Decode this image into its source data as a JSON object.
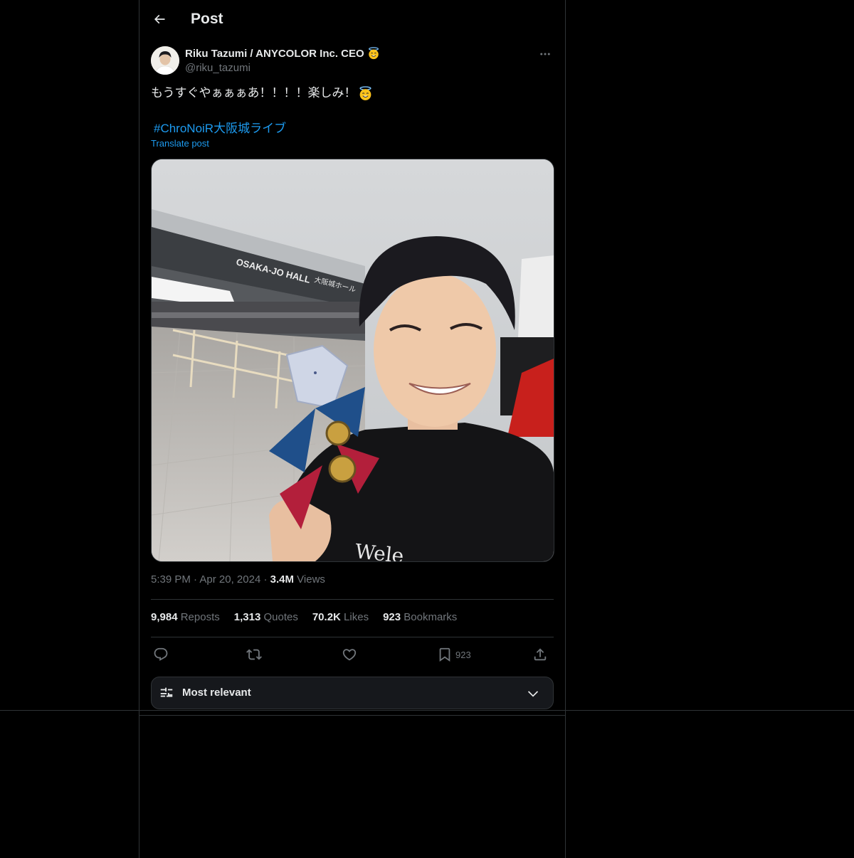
{
  "header": {
    "back_icon": "arrow-left-icon",
    "title": "Post"
  },
  "author": {
    "display_name": "Riku Tazumi / ANYCOLOR Inc. CEO",
    "name_emoji": "smiling-face-with-halo-icon",
    "handle": "@riku_tazumi",
    "more_icon": "more-horizontal-icon"
  },
  "post": {
    "text": "もうすぐやぁぁぁあ！！！！楽しみ！",
    "text_emoji": "smiling-face-with-halo-icon",
    "hashtag": "#ChroNoiR大阪城ライブ",
    "translate_label": "Translate post",
    "media_sign_text": "OSAKA-JO HALL",
    "media_sign_jp": "大阪城ホール",
    "media_shirt_text": "Wele"
  },
  "meta": {
    "time": "5:39 PM",
    "sep1": "·",
    "date": "Apr 20, 2024",
    "sep2": "·",
    "views_count": "3.4M",
    "views_label": "Views"
  },
  "stats": [
    {
      "count": "9,984",
      "label": "Reposts"
    },
    {
      "count": "1,313",
      "label": "Quotes"
    },
    {
      "count": "70.2K",
      "label": "Likes"
    },
    {
      "count": "923",
      "label": "Bookmarks"
    }
  ],
  "actions": {
    "reply_icon": "reply-icon",
    "repost_icon": "repost-icon",
    "like_icon": "heart-icon",
    "bookmark_icon": "bookmark-icon",
    "bookmark_count": "923",
    "share_icon": "share-icon"
  },
  "sort": {
    "icon": "sliders-icon",
    "label": "Most relevant",
    "chevron": "chevron-down-icon"
  },
  "colors": {
    "background": "#000000",
    "text_primary": "#e7e9ea",
    "text_secondary": "#71767b",
    "accent": "#1d9bf0",
    "border": "#2f3336"
  }
}
